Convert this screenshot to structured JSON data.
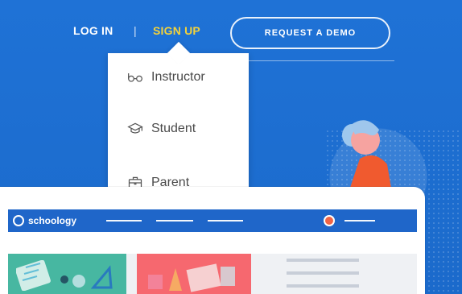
{
  "nav": {
    "login": "LOG IN",
    "separator": "|",
    "signup": "SIGN UP",
    "demo": "REQUEST A DEMO"
  },
  "dropdown": {
    "items": [
      {
        "label": "Instructor",
        "icon": "glasses-icon"
      },
      {
        "label": "Student",
        "icon": "graduation-cap-icon"
      },
      {
        "label": "Parent",
        "icon": "briefcase-icon"
      }
    ]
  },
  "app_preview": {
    "logo": "schoology"
  },
  "colors": {
    "background_blue": "#1f72d6",
    "signup_yellow": "#f2d23b",
    "app_bar_blue": "#1f66c9",
    "accent_orange": "#f06445"
  }
}
